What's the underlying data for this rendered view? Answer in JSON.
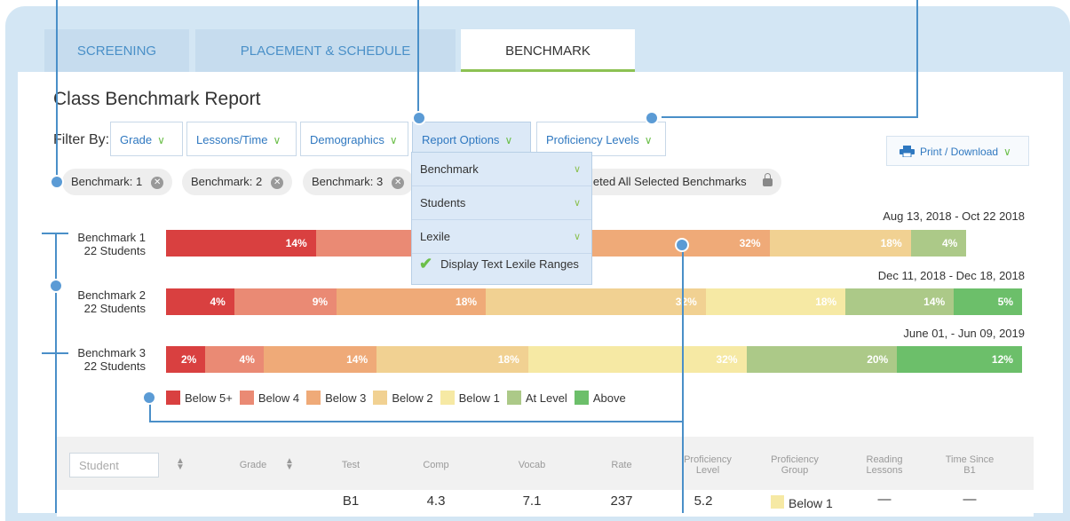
{
  "tabs": [
    {
      "label": "SCREENING"
    },
    {
      "label": "PLACEMENT & SCHEDULE"
    },
    {
      "label": "BENCHMARK"
    }
  ],
  "page_title": "Class Benchmark Report",
  "filter": {
    "label": "Filter By:",
    "buttons": [
      {
        "label": "Grade"
      },
      {
        "label": "Lessons/Time"
      },
      {
        "label": "Demographics"
      },
      {
        "label": "Report Options"
      },
      {
        "label": "Proficiency Levels"
      }
    ],
    "print_label": "Print / Download"
  },
  "chips": [
    {
      "label": "Benchmark: 1"
    },
    {
      "label": "Benchmark: 2"
    },
    {
      "label": "Benchmark: 3"
    },
    {
      "label": "leted All Selected Benchmarks"
    }
  ],
  "dropdown": {
    "items": [
      {
        "label": "Benchmark"
      },
      {
        "label": "Students"
      },
      {
        "label": "Lexile"
      }
    ],
    "check_label": "Display Text Lexile Ranges"
  },
  "colors": {
    "below5": "#d94040",
    "below4": "#ea8a74",
    "below3": "#efaa78",
    "below2": "#f1d192",
    "below1": "#f6e9a4",
    "at_level": "#acc988",
    "above": "#6cbf6a"
  },
  "benchmarks": [
    {
      "name": "Benchmark 1",
      "students": "22 Students",
      "date": "Aug 13, 2018 - Oct 22 2018",
      "segments": [
        {
          "level": "below5",
          "pct": 17.5,
          "label": "14%"
        },
        {
          "level": "below4",
          "pct": 12.5,
          "label": ""
        },
        {
          "level": "below3",
          "pct": 40.5,
          "label": "32%"
        },
        {
          "level": "below2",
          "pct": 16.5,
          "label": "18%"
        },
        {
          "level": "at_level",
          "pct": 6.5,
          "label": "4%"
        }
      ]
    },
    {
      "name": "Benchmark 2",
      "students": "22 Students",
      "date": "Dec 11, 2018 - Dec 18, 2018",
      "segments": [
        {
          "level": "below5",
          "pct": 8.0,
          "label": "4%"
        },
        {
          "level": "below4",
          "pct": 12.0,
          "label": "9%"
        },
        {
          "level": "below3",
          "pct": 17.5,
          "label": "18%"
        },
        {
          "level": "below2",
          "pct": 25.8,
          "label": "32%"
        },
        {
          "level": "below1",
          "pct": 16.4,
          "label": "18%"
        },
        {
          "level": "at_level",
          "pct": 12.7,
          "label": "14%"
        },
        {
          "level": "above",
          "pct": 8.0,
          "label": "5%"
        }
      ]
    },
    {
      "name": "Benchmark 3",
      "students": "22 Students",
      "date": "June 01, - Jun 09, 2019",
      "segments": [
        {
          "level": "below5",
          "pct": 4.6,
          "label": "2%"
        },
        {
          "level": "below4",
          "pct": 6.8,
          "label": "4%"
        },
        {
          "level": "below3",
          "pct": 13.2,
          "label": "14%"
        },
        {
          "level": "below2",
          "pct": 17.7,
          "label": "18%"
        },
        {
          "level": "below1",
          "pct": 25.5,
          "label": "32%"
        },
        {
          "level": "at_level",
          "pct": 17.6,
          "label": "20%"
        },
        {
          "level": "above",
          "pct": 14.6,
          "label": "12%"
        }
      ]
    }
  ],
  "legend": [
    {
      "level": "below5",
      "label": "Below 5+"
    },
    {
      "level": "below4",
      "label": "Below 4"
    },
    {
      "level": "below3",
      "label": "Below 3"
    },
    {
      "level": "below2",
      "label": "Below 2"
    },
    {
      "level": "below1",
      "label": "Below 1"
    },
    {
      "level": "at_level",
      "label": "At Level"
    },
    {
      "level": "above",
      "label": "Above"
    }
  ],
  "table": {
    "student_placeholder": "Student",
    "headers": [
      "Grade",
      "Test",
      "Comp",
      "Vocab",
      "Rate",
      "Proficiency Level",
      "Proficiency Group",
      "Reading Lessons",
      "Time Since B1"
    ],
    "row": {
      "test": "B1",
      "comp": "4.3",
      "vocab": "7.1",
      "rate": "237",
      "proficiency_level": "5.2",
      "proficiency_group": "Below 1",
      "reading_lessons": "—",
      "time_since_b1": "—"
    }
  }
}
